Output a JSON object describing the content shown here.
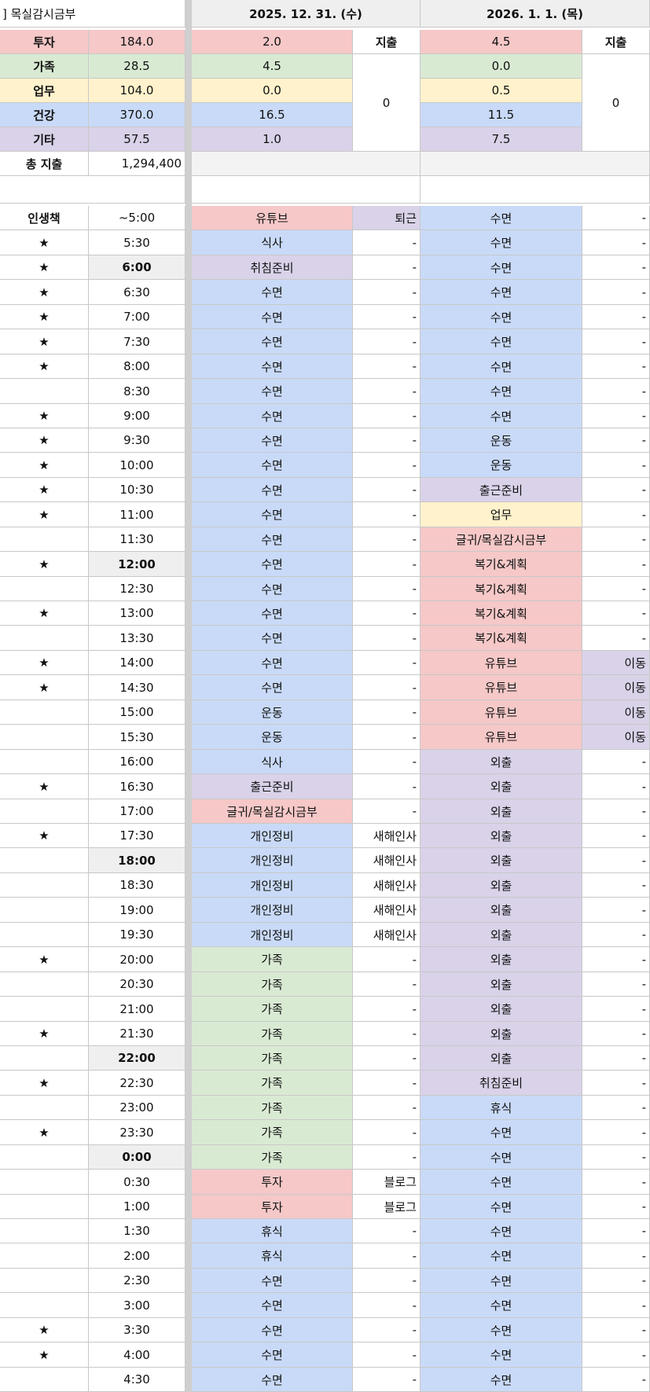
{
  "sheet_title": "] 목실감시금부",
  "dates": [
    "2025. 12. 31. (수)",
    "2026. 1. 1. (목)"
  ],
  "expense_label": "지출",
  "summary": [
    {
      "label": "투자",
      "total": "184.0",
      "d1": "2.0",
      "d2": "4.5",
      "cls": "inv"
    },
    {
      "label": "가족",
      "total": "28.5",
      "d1": "4.5",
      "d2": "0.0",
      "cls": "fam"
    },
    {
      "label": "업무",
      "total": "104.0",
      "d1": "0.0",
      "d2": "0.5",
      "cls": "wrk"
    },
    {
      "label": "건강",
      "total": "370.0",
      "d1": "16.5",
      "d2": "11.5",
      "cls": "hlt"
    },
    {
      "label": "기타",
      "total": "57.5",
      "d1": "1.0",
      "d2": "7.5",
      "cls": "etc"
    }
  ],
  "expense_values": [
    "0",
    "0"
  ],
  "total_expense": {
    "label": "총 지출",
    "value": "1,294,400"
  },
  "schedule_header": "인생책",
  "rows": [
    {
      "star": "",
      "time": "~5:00",
      "tb": 0,
      "a": "유튜브",
      "ac": "inv",
      "n1": "퇴근",
      "n1c": "etc",
      "b": "수면",
      "bc": "hlt",
      "n2": "-",
      "n2c": ""
    },
    {
      "star": "★",
      "time": "5:30",
      "tb": 0,
      "a": "식사",
      "ac": "hlt",
      "n1": "-",
      "n1c": "",
      "b": "수면",
      "bc": "hlt",
      "n2": "-",
      "n2c": ""
    },
    {
      "star": "★",
      "time": "6:00",
      "tb": 1,
      "a": "취침준비",
      "ac": "etc",
      "n1": "-",
      "n1c": "",
      "b": "수면",
      "bc": "hlt",
      "n2": "-",
      "n2c": ""
    },
    {
      "star": "★",
      "time": "6:30",
      "tb": 0,
      "a": "수면",
      "ac": "hlt",
      "n1": "-",
      "n1c": "",
      "b": "수면",
      "bc": "hlt",
      "n2": "-",
      "n2c": ""
    },
    {
      "star": "★",
      "time": "7:00",
      "tb": 0,
      "a": "수면",
      "ac": "hlt",
      "n1": "-",
      "n1c": "",
      "b": "수면",
      "bc": "hlt",
      "n2": "-",
      "n2c": ""
    },
    {
      "star": "★",
      "time": "7:30",
      "tb": 0,
      "a": "수면",
      "ac": "hlt",
      "n1": "-",
      "n1c": "",
      "b": "수면",
      "bc": "hlt",
      "n2": "-",
      "n2c": ""
    },
    {
      "star": "★",
      "time": "8:00",
      "tb": 0,
      "a": "수면",
      "ac": "hlt",
      "n1": "-",
      "n1c": "",
      "b": "수면",
      "bc": "hlt",
      "n2": "-",
      "n2c": ""
    },
    {
      "star": "",
      "time": "8:30",
      "tb": 0,
      "a": "수면",
      "ac": "hlt",
      "n1": "-",
      "n1c": "",
      "b": "수면",
      "bc": "hlt",
      "n2": "-",
      "n2c": ""
    },
    {
      "star": "★",
      "time": "9:00",
      "tb": 0,
      "a": "수면",
      "ac": "hlt",
      "n1": "-",
      "n1c": "",
      "b": "수면",
      "bc": "hlt",
      "n2": "-",
      "n2c": ""
    },
    {
      "star": "★",
      "time": "9:30",
      "tb": 0,
      "a": "수면",
      "ac": "hlt",
      "n1": "-",
      "n1c": "",
      "b": "운동",
      "bc": "hlt",
      "n2": "-",
      "n2c": ""
    },
    {
      "star": "★",
      "time": "10:00",
      "tb": 0,
      "a": "수면",
      "ac": "hlt",
      "n1": "-",
      "n1c": "",
      "b": "운동",
      "bc": "hlt",
      "n2": "-",
      "n2c": ""
    },
    {
      "star": "★",
      "time": "10:30",
      "tb": 0,
      "a": "수면",
      "ac": "hlt",
      "n1": "-",
      "n1c": "",
      "b": "출근준비",
      "bc": "etc",
      "n2": "-",
      "n2c": ""
    },
    {
      "star": "★",
      "time": "11:00",
      "tb": 0,
      "a": "수면",
      "ac": "hlt",
      "n1": "-",
      "n1c": "",
      "b": "업무",
      "bc": "wrk",
      "n2": "-",
      "n2c": ""
    },
    {
      "star": "",
      "time": "11:30",
      "tb": 0,
      "a": "수면",
      "ac": "hlt",
      "n1": "-",
      "n1c": "",
      "b": "글귀/목실감시금부",
      "bc": "inv",
      "n2": "-",
      "n2c": ""
    },
    {
      "star": "★",
      "time": "12:00",
      "tb": 1,
      "a": "수면",
      "ac": "hlt",
      "n1": "-",
      "n1c": "",
      "b": "복기&계획",
      "bc": "inv",
      "n2": "-",
      "n2c": ""
    },
    {
      "star": "",
      "time": "12:30",
      "tb": 0,
      "a": "수면",
      "ac": "hlt",
      "n1": "-",
      "n1c": "",
      "b": "복기&계획",
      "bc": "inv",
      "n2": "-",
      "n2c": ""
    },
    {
      "star": "★",
      "time": "13:00",
      "tb": 0,
      "a": "수면",
      "ac": "hlt",
      "n1": "-",
      "n1c": "",
      "b": "복기&계획",
      "bc": "inv",
      "n2": "-",
      "n2c": ""
    },
    {
      "star": "",
      "time": "13:30",
      "tb": 0,
      "a": "수면",
      "ac": "hlt",
      "n1": "-",
      "n1c": "",
      "b": "복기&계획",
      "bc": "inv",
      "n2": "-",
      "n2c": ""
    },
    {
      "star": "★",
      "time": "14:00",
      "tb": 0,
      "a": "수면",
      "ac": "hlt",
      "n1": "-",
      "n1c": "",
      "b": "유튜브",
      "bc": "inv",
      "n2": "이동",
      "n2c": "etc"
    },
    {
      "star": "★",
      "time": "14:30",
      "tb": 0,
      "a": "수면",
      "ac": "hlt",
      "n1": "-",
      "n1c": "",
      "b": "유튜브",
      "bc": "inv",
      "n2": "이동",
      "n2c": "etc"
    },
    {
      "star": "",
      "time": "15:00",
      "tb": 0,
      "a": "운동",
      "ac": "hlt",
      "n1": "-",
      "n1c": "",
      "b": "유튜브",
      "bc": "inv",
      "n2": "이동",
      "n2c": "etc"
    },
    {
      "star": "",
      "time": "15:30",
      "tb": 0,
      "a": "운동",
      "ac": "hlt",
      "n1": "-",
      "n1c": "",
      "b": "유튜브",
      "bc": "inv",
      "n2": "이동",
      "n2c": "etc"
    },
    {
      "star": "",
      "time": "16:00",
      "tb": 0,
      "a": "식사",
      "ac": "hlt",
      "n1": "-",
      "n1c": "",
      "b": "외출",
      "bc": "etc",
      "n2": "-",
      "n2c": ""
    },
    {
      "star": "★",
      "time": "16:30",
      "tb": 0,
      "a": "출근준비",
      "ac": "etc",
      "n1": "-",
      "n1c": "",
      "b": "외출",
      "bc": "etc",
      "n2": "-",
      "n2c": ""
    },
    {
      "star": "",
      "time": "17:00",
      "tb": 0,
      "a": "글귀/목실감시금부",
      "ac": "inv",
      "n1": "-",
      "n1c": "",
      "b": "외출",
      "bc": "etc",
      "n2": "-",
      "n2c": ""
    },
    {
      "star": "★",
      "time": "17:30",
      "tb": 0,
      "a": "개인정비",
      "ac": "hlt",
      "n1": "새해인사",
      "n1c": "",
      "b": "외출",
      "bc": "etc",
      "n2": "-",
      "n2c": ""
    },
    {
      "star": "",
      "time": "18:00",
      "tb": 1,
      "a": "개인정비",
      "ac": "hlt",
      "n1": "새해인사",
      "n1c": "",
      "b": "외출",
      "bc": "etc",
      "n2": "-",
      "n2c": ""
    },
    {
      "star": "",
      "time": "18:30",
      "tb": 0,
      "a": "개인정비",
      "ac": "hlt",
      "n1": "새해인사",
      "n1c": "",
      "b": "외출",
      "bc": "etc",
      "n2": "-",
      "n2c": ""
    },
    {
      "star": "",
      "time": "19:00",
      "tb": 0,
      "a": "개인정비",
      "ac": "hlt",
      "n1": "새해인사",
      "n1c": "",
      "b": "외출",
      "bc": "etc",
      "n2": "-",
      "n2c": ""
    },
    {
      "star": "",
      "time": "19:30",
      "tb": 0,
      "a": "개인정비",
      "ac": "hlt",
      "n1": "새해인사",
      "n1c": "",
      "b": "외출",
      "bc": "etc",
      "n2": "-",
      "n2c": ""
    },
    {
      "star": "★",
      "time": "20:00",
      "tb": 0,
      "a": "가족",
      "ac": "fam",
      "n1": "-",
      "n1c": "",
      "b": "외출",
      "bc": "etc",
      "n2": "-",
      "n2c": ""
    },
    {
      "star": "",
      "time": "20:30",
      "tb": 0,
      "a": "가족",
      "ac": "fam",
      "n1": "-",
      "n1c": "",
      "b": "외출",
      "bc": "etc",
      "n2": "-",
      "n2c": ""
    },
    {
      "star": "",
      "time": "21:00",
      "tb": 0,
      "a": "가족",
      "ac": "fam",
      "n1": "-",
      "n1c": "",
      "b": "외출",
      "bc": "etc",
      "n2": "-",
      "n2c": ""
    },
    {
      "star": "★",
      "time": "21:30",
      "tb": 0,
      "a": "가족",
      "ac": "fam",
      "n1": "-",
      "n1c": "",
      "b": "외출",
      "bc": "etc",
      "n2": "-",
      "n2c": ""
    },
    {
      "star": "",
      "time": "22:00",
      "tb": 1,
      "a": "가족",
      "ac": "fam",
      "n1": "-",
      "n1c": "",
      "b": "외출",
      "bc": "etc",
      "n2": "-",
      "n2c": ""
    },
    {
      "star": "★",
      "time": "22:30",
      "tb": 0,
      "a": "가족",
      "ac": "fam",
      "n1": "-",
      "n1c": "",
      "b": "취침준비",
      "bc": "etc",
      "n2": "-",
      "n2c": ""
    },
    {
      "star": "",
      "time": "23:00",
      "tb": 0,
      "a": "가족",
      "ac": "fam",
      "n1": "-",
      "n1c": "",
      "b": "휴식",
      "bc": "hlt",
      "n2": "-",
      "n2c": ""
    },
    {
      "star": "★",
      "time": "23:30",
      "tb": 0,
      "a": "가족",
      "ac": "fam",
      "n1": "-",
      "n1c": "",
      "b": "수면",
      "bc": "hlt",
      "n2": "-",
      "n2c": ""
    },
    {
      "star": "",
      "time": "0:00",
      "tb": 1,
      "a": "가족",
      "ac": "fam",
      "n1": "-",
      "n1c": "",
      "b": "수면",
      "bc": "hlt",
      "n2": "-",
      "n2c": ""
    },
    {
      "star": "",
      "time": "0:30",
      "tb": 0,
      "a": "투자",
      "ac": "inv",
      "n1": "블로그",
      "n1c": "",
      "b": "수면",
      "bc": "hlt",
      "n2": "-",
      "n2c": ""
    },
    {
      "star": "",
      "time": "1:00",
      "tb": 0,
      "a": "투자",
      "ac": "inv",
      "n1": "블로그",
      "n1c": "",
      "b": "수면",
      "bc": "hlt",
      "n2": "-",
      "n2c": ""
    },
    {
      "star": "",
      "time": "1:30",
      "tb": 0,
      "a": "휴식",
      "ac": "hlt",
      "n1": "-",
      "n1c": "",
      "b": "수면",
      "bc": "hlt",
      "n2": "-",
      "n2c": ""
    },
    {
      "star": "",
      "time": "2:00",
      "tb": 0,
      "a": "휴식",
      "ac": "hlt",
      "n1": "-",
      "n1c": "",
      "b": "수면",
      "bc": "hlt",
      "n2": "-",
      "n2c": ""
    },
    {
      "star": "",
      "time": "2:30",
      "tb": 0,
      "a": "수면",
      "ac": "hlt",
      "n1": "-",
      "n1c": "",
      "b": "수면",
      "bc": "hlt",
      "n2": "-",
      "n2c": ""
    },
    {
      "star": "",
      "time": "3:00",
      "tb": 0,
      "a": "수면",
      "ac": "hlt",
      "n1": "-",
      "n1c": "",
      "b": "수면",
      "bc": "hlt",
      "n2": "-",
      "n2c": ""
    },
    {
      "star": "★",
      "time": "3:30",
      "tb": 0,
      "a": "수면",
      "ac": "hlt",
      "n1": "-",
      "n1c": "",
      "b": "수면",
      "bc": "hlt",
      "n2": "-",
      "n2c": ""
    },
    {
      "star": "★",
      "time": "4:00",
      "tb": 0,
      "a": "수면",
      "ac": "hlt",
      "n1": "-",
      "n1c": "",
      "b": "수면",
      "bc": "hlt",
      "n2": "-",
      "n2c": ""
    },
    {
      "star": "",
      "time": "4:30",
      "tb": 0,
      "a": "수면",
      "ac": "hlt",
      "n1": "-",
      "n1c": "",
      "b": "수면",
      "bc": "hlt",
      "n2": "-",
      "n2c": ""
    }
  ]
}
